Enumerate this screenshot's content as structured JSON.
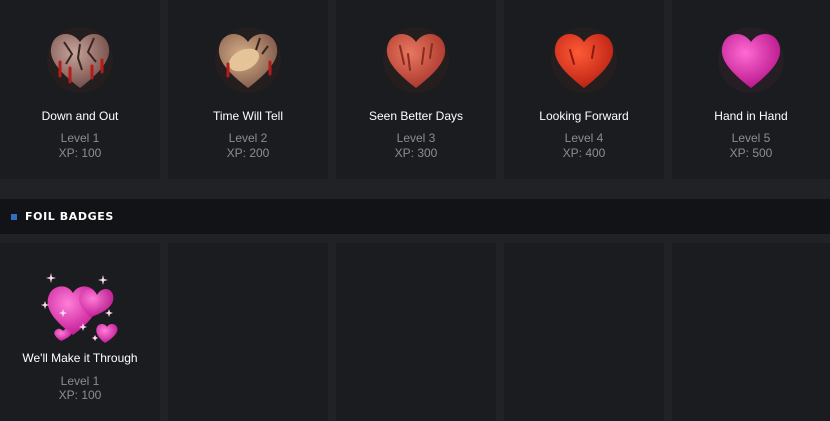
{
  "badges": [
    {
      "name": "Down and Out",
      "level": "Level 1",
      "xp": "XP: 100",
      "color": "#9b7a73",
      "icon": "broken-heart-icon"
    },
    {
      "name": "Time Will Tell",
      "level": "Level 2",
      "xp": "XP: 200",
      "color": "#b18a76",
      "icon": "bandaged-heart-icon"
    },
    {
      "name": "Seen Better Days",
      "level": "Level 3",
      "xp": "XP: 300",
      "color": "#d2523d",
      "icon": "scratched-heart-icon"
    },
    {
      "name": "Looking Forward",
      "level": "Level 4",
      "xp": "XP: 400",
      "color": "#e43a22",
      "icon": "healing-heart-icon"
    },
    {
      "name": "Hand in Hand",
      "level": "Level 5",
      "xp": "XP: 500",
      "color": "#e52aa8",
      "icon": "pink-heart-icon"
    }
  ],
  "foil_section": {
    "title": "FOIL BADGES",
    "accent": "#2f6fc1"
  },
  "foil_badges": [
    {
      "name": "We'll Make it Through",
      "level": "Level 1",
      "xp": "XP: 100",
      "color": "#e52aa8",
      "icon": "sparkling-hearts-icon"
    }
  ]
}
